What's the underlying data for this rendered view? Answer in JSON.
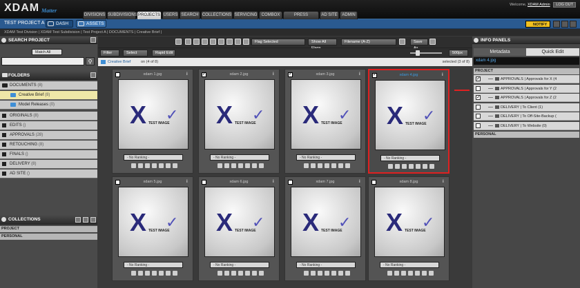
{
  "app": {
    "logo": "XDAM",
    "logo_sub": "Matter"
  },
  "top_tabs": [
    "DIVISIONS",
    "SUBDIVISIONS",
    "PROJECTS",
    "USERS",
    "SEARCH",
    "COLLECTIONS",
    "SERVICING",
    "COMBOX",
    "PRESS RELEASES",
    "AD SITE",
    "ADMIN"
  ],
  "welcome": {
    "prefix": "Welcome,",
    "user": "XDAM Admin",
    "logout": "LOG OUT"
  },
  "subbar": {
    "project": "TEST PROJECT A",
    "dash": "DASH",
    "assets": "ASSETS",
    "notify": "NOTIFY"
  },
  "breadcrumb": "XDAM Test Division | XDAM Test Subdivision | Test Project A | DOCUMENTS | Creative Brief |",
  "search": {
    "header": "SEARCH PROJECT",
    "match": "Match All"
  },
  "folders": {
    "header": "FOLDERS",
    "items": [
      {
        "label": "DOCUMENTS",
        "count": "(8)"
      },
      {
        "label": "Creative Brief",
        "count": "(8)"
      },
      {
        "label": "Model Releases",
        "count": "(0)"
      },
      {
        "label": "ORIGINALS",
        "count": "(8)"
      },
      {
        "label": "EDITS",
        "count": "()"
      },
      {
        "label": "APPROVALS",
        "count": "(28)"
      },
      {
        "label": "RETOUCHING",
        "count": "(8)"
      },
      {
        "label": "FINALS",
        "count": "()"
      },
      {
        "label": "DELIVERY",
        "count": "(8)"
      },
      {
        "label": "AD SITE",
        "count": "()"
      }
    ]
  },
  "collections": {
    "header": "COLLECTIONS",
    "project": "PROJECT",
    "personal": "PERSONAL"
  },
  "toolbar": {
    "flag": "Flag Selected",
    "show_flags": "Show All Flags",
    "sort": "Filename (A-Z)",
    "save_as": "Save As",
    "filter": "Filter",
    "select": "Select",
    "rapid_edit": "Rapid Edit",
    "zoom": "500px",
    "folder_path": "Creative Brief",
    "folder_count": "on (4 of 8)",
    "selected": "selected (3 of 8)"
  },
  "assets": [
    {
      "name": "xdam 1.jpg",
      "checked": false,
      "selected": false
    },
    {
      "name": "xdam 2.jpg",
      "checked": true,
      "selected": false
    },
    {
      "name": "xdam 3.jpg",
      "checked": true,
      "selected": false
    },
    {
      "name": "xdam 4.jpg",
      "checked": true,
      "selected": true
    },
    {
      "name": "xdam 5.jpg",
      "checked": false,
      "selected": false
    },
    {
      "name": "xdam 6.jpg",
      "checked": false,
      "selected": false
    },
    {
      "name": "xdam 7.jpg",
      "checked": false,
      "selected": false
    },
    {
      "name": "xdam 8.jpg",
      "checked": false,
      "selected": false
    }
  ],
  "thumb_text": "TEST IMAGE",
  "ranking": "- No Ranking -",
  "info": {
    "header": "INFO PANELS",
    "tab_meta": "Metadata",
    "tab_quick": "Quick Edit",
    "filename": "xdam 4.jpg",
    "project": "PROJECT",
    "personal": "PERSONAL",
    "rows": [
      {
        "label": "APPROVALS | Approvals for X",
        "count": "(4",
        "checked": true
      },
      {
        "label": "APPROVALS | Approvals for Y",
        "count": "(2",
        "checked": false
      },
      {
        "label": "APPROVALS | Approvals for Z",
        "count": "(2",
        "checked": true
      },
      {
        "label": "DELIVERY | To Client",
        "count": "(1)",
        "checked": false
      },
      {
        "label": "DELIVERY | To Off-Site-Backup",
        "count": "(",
        "checked": false
      },
      {
        "label": "DELIVERY | To Website",
        "count": "(0)",
        "checked": false
      }
    ]
  }
}
